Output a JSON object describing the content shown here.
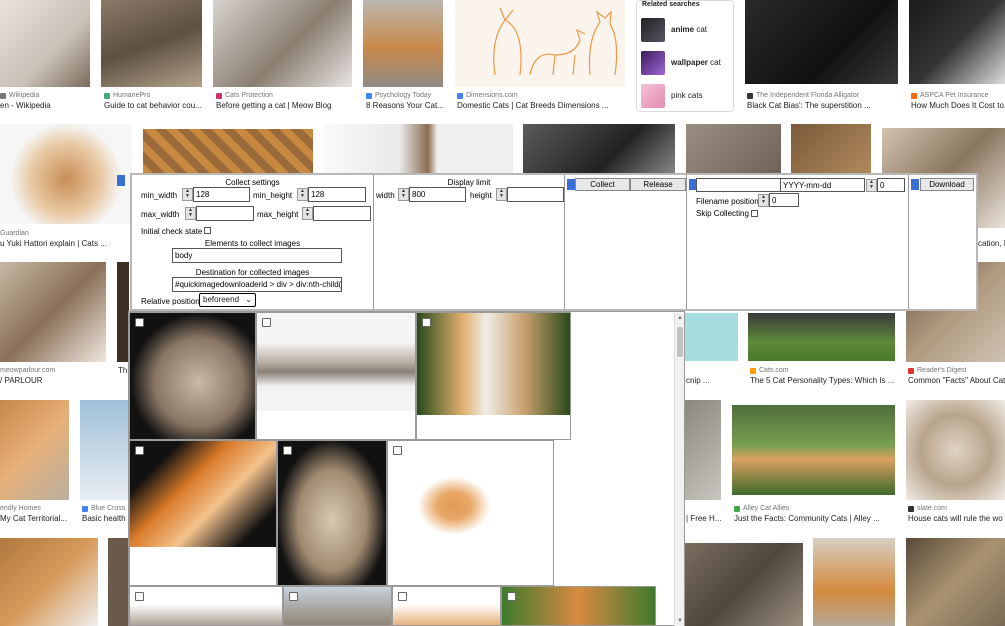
{
  "background_results": [
    {
      "source": "Wikipedia",
      "title": "en - Wikipedia"
    },
    {
      "source": "HumanePro",
      "title": "Guide to cat behavior cou..."
    },
    {
      "source": "Cats Protection",
      "title": "Before getting a cat | Meow Blog"
    },
    {
      "source": "Psychology Today",
      "title": "8 Reasons Your Cat..."
    },
    {
      "source": "Dimensions.com",
      "title": "Domestic Cats | Cat Breeds Dimensions ..."
    },
    {
      "source": "The Independent Florida Alligator",
      "title": "Black Cat Bias': The superstition ..."
    },
    {
      "source": "ASPCA Pet Insurance",
      "title": "How Much Does It Cost to..."
    },
    {
      "source": "Guardian",
      "title": "u Yuki Hattori explain | Cats ..."
    },
    {
      "source": "",
      "title": "cation, I"
    },
    {
      "source": "meowparlour.com",
      "title": "/ PARLOUR"
    },
    {
      "source": "",
      "title": "Th"
    },
    {
      "source": "",
      "title": "cnip ..."
    },
    {
      "source": "Cats.com",
      "title": "The 5 Cat Personality Types: Which Is ..."
    },
    {
      "source": "Reader's Digest",
      "title": "Common \"Facts\" About Cat"
    },
    {
      "source": "endly Homes",
      "title": "My Cat Territorial..."
    },
    {
      "source": "Blue Cross",
      "title": "Basic health"
    },
    {
      "source": "",
      "title": "| Free H..."
    },
    {
      "source": "Alley Cat Allies",
      "title": "Just the Facts: Community Cats | Alley ..."
    },
    {
      "source": "slate.com",
      "title": "House cats will rule the wo"
    }
  ],
  "related": {
    "header": "Related searches",
    "items": [
      {
        "bold": "anime",
        "rest": " cat"
      },
      {
        "bold": "wallpaper",
        "rest": " cat"
      },
      {
        "bold": "",
        "rest": "pink cats"
      }
    ]
  },
  "panel": {
    "collect_settings": {
      "title": "Collect settings",
      "min_width_label": "min_width",
      "min_width_value": "128",
      "min_height_label": "min_height",
      "min_height_value": "128",
      "max_width_label": "max_width",
      "max_width_value": "",
      "max_height_label": "max_height",
      "max_height_value": "",
      "initial_check_label": "Initial check state",
      "elements_label": "Elements to collect images",
      "elements_value": "body",
      "destination_label": "Destination for collected images",
      "destination_value": "#quickimagedownloaderid > div > div:nth-child(2",
      "relative_position_label": "Relative position",
      "relative_position_value": "beforeend"
    },
    "display_limit": {
      "title": "Display limit",
      "width_label": "width",
      "width_value": "800",
      "height_label": "height",
      "height_value": ""
    },
    "actions": {
      "collect_label": "Collect",
      "release_label": "Release"
    },
    "filename": {
      "prefix_value": "",
      "date_value": "YYYY-mm-dd",
      "counter_value": "0",
      "position_label": "Filename position",
      "position_value": "0",
      "skip_label": "Skip Collecting"
    },
    "download_label": "Download"
  },
  "colors": {
    "accent_tab": "#3b6fd8",
    "panel_border": "#b8b8b8"
  }
}
